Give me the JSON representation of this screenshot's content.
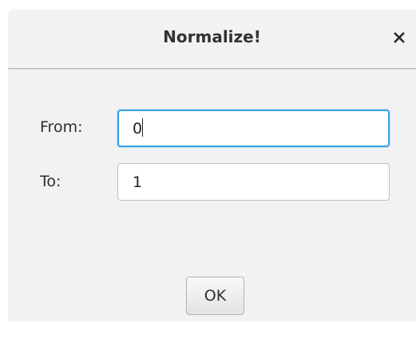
{
  "dialog": {
    "title": "Normalize!",
    "close_icon": "close-icon"
  },
  "form": {
    "from_label": "From:",
    "from_value": "0",
    "to_label": "To:",
    "to_value": "1"
  },
  "actions": {
    "ok_label": "OK"
  },
  "colors": {
    "focus_ring": "#36a2de",
    "dialog_background": "#f2f2f2"
  }
}
